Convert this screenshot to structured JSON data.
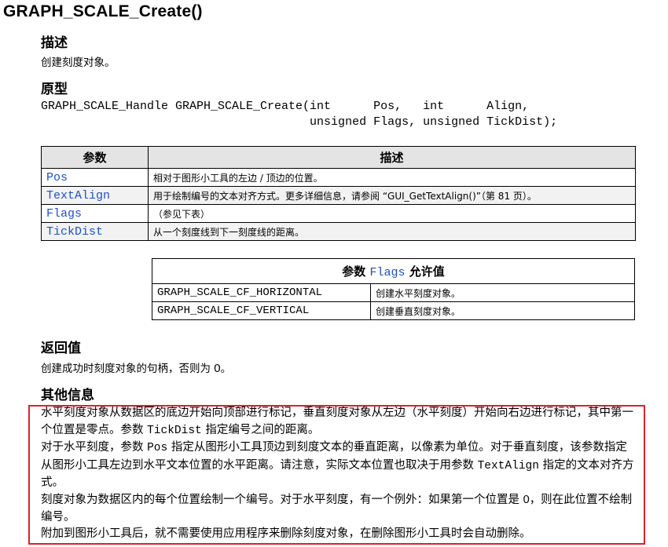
{
  "title": "GRAPH_SCALE_Create()",
  "sections": {
    "desc_heading": "描述",
    "desc_text": "创建刻度对象。",
    "proto_heading": "原型",
    "proto_line1": "GRAPH_SCALE_Handle GRAPH_SCALE_Create(int      Pos,   int      Align,",
    "proto_line2": "                                      unsigned Flags, unsigned TickDist);",
    "ret_heading": "返回值",
    "ret_text_a": "创建成功时刻度对象的句柄，否则为 ",
    "ret_text_b": "0",
    "ret_text_c": "。",
    "other_heading": "其他信息"
  },
  "param_table": {
    "headers": [
      "参数",
      "描述"
    ],
    "rows": [
      {
        "name": "Pos",
        "desc": "相对于图形小工具的左边 / 顶边的位置。"
      },
      {
        "name": "TextAlign",
        "desc": "用于绘制编号的文本对齐方式。更多详细信息，请参阅 “GUI_GetTextAlign()”（第 81 页）。"
      },
      {
        "name": "Flags",
        "desc": "（参见下表）"
      },
      {
        "name": "TickDist",
        "desc": "从一个刻度线到下一刻度线的距离。"
      }
    ]
  },
  "flags_table": {
    "header_a": "参数 ",
    "header_b": "Flags",
    "header_c": " 允许值",
    "rows": [
      {
        "name": "GRAPH_SCALE_CF_HORIZONTAL",
        "desc": "创建水平刻度对象。"
      },
      {
        "name": "GRAPH_SCALE_CF_VERTICAL",
        "desc": "创建垂直刻度对象。"
      }
    ]
  },
  "other": {
    "p1a": "水平刻度对象从数据区的底边开始向顶部进行标记，垂直刻度对象从左边（水平刻度）开始向右边进行标记，其中第一个位置是零点。参数 ",
    "p1b": "TickDist",
    "p1c": " 指定编号之间的距离。",
    "p2a": "对于水平刻度，参数 ",
    "p2b": "Pos",
    "p2c": " 指定从图形小工具顶边到刻度文本的垂直距离，以像素为单位。对于垂直刻度，该参数指定从图形小工具左边到水平文本位置的水平距离。请注意，实际文本位置也取决于用参数 ",
    "p2d": "TextAlign",
    "p2e": " 指定的文本对齐方式。",
    "p3a": "刻度对象为数据区内的每个位置绘制一个编号。对于水平刻度，有一个例外：如果第一个位置是 ",
    "p3b": "0",
    "p3c": "，则在此位置不绘制编号。",
    "p4": "附加到图形小工具后，就不需要使用应用程序来删除刻度对象，在删除图形小工具时会自动删除。"
  },
  "colors": {
    "link": "#1e50c8",
    "highlight_border": "#e0202a",
    "header_bg": "#e4e4e4"
  }
}
